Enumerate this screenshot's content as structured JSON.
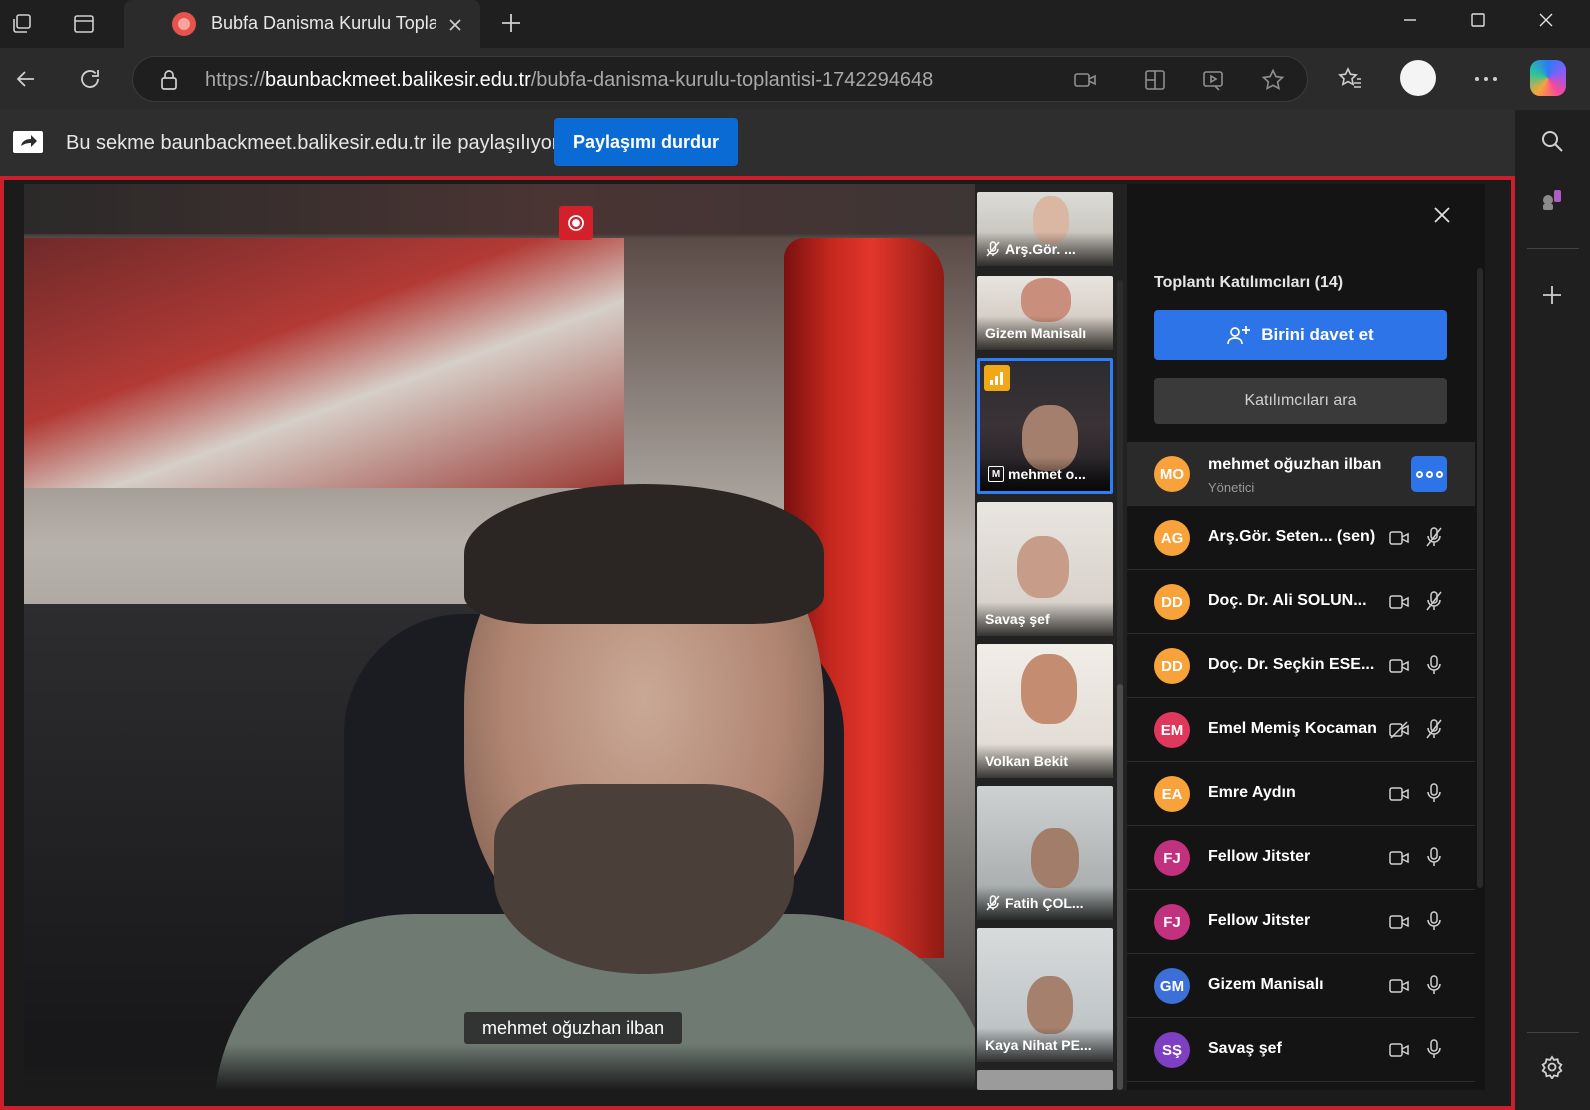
{
  "browser": {
    "tab_title": "Bubfa Danisma Kurulu Toplantısı",
    "url_scheme": "https://",
    "url_host": "baunbackmeet.balikesir.edu.tr",
    "url_path": "/bubfa-danisma-kurulu-toplantisi-1742294648",
    "icons": [
      "collections-icon",
      "tab-actions-icon",
      "favicon-icon",
      "close-icon",
      "new-tab-icon",
      "minimize-icon",
      "maximize-icon",
      "window-close-icon",
      "back-icon",
      "refresh-icon",
      "lock-icon",
      "camera-icon",
      "split-screen-icon",
      "immersive-reader-icon",
      "star-icon",
      "favorites-icon",
      "profile-icon",
      "more-icon",
      "copilot-icon",
      "search-icon",
      "games-icon",
      "add-icon",
      "settings-icon"
    ]
  },
  "share_bar": {
    "message": "Bu sekme baunbackmeet.balikesir.edu.tr ile paylaşılıyor",
    "stop_button": "Paylaşımı durdur"
  },
  "meeting": {
    "active_speaker": "mehmet oğuzhan ilban",
    "recording": true,
    "thumbnails": [
      {
        "name": "Arş.Gör. ...",
        "muted": true
      },
      {
        "name": "Gizem Manisalı",
        "muted": false
      },
      {
        "name": "mehmet o...",
        "muted": false,
        "active": true
      },
      {
        "name": "Savaş şef",
        "muted": false
      },
      {
        "name": "Volkan Bekit",
        "muted": false
      },
      {
        "name": "Fatih ÇOL...",
        "muted": true
      },
      {
        "name": "Kaya Nihat PE...",
        "muted": false
      }
    ],
    "thumb_badge": "M"
  },
  "participants_panel": {
    "title": "Toplantı Katılımcıları (14)",
    "invite_label": "Birini davet et",
    "search_placeholder": "Katılımcıları ara",
    "host": {
      "initials": "MO",
      "name": "mehmet oğuzhan ilban",
      "role": "Yönetici",
      "color": "#f7a23a"
    },
    "participants": [
      {
        "initials": "AG",
        "name": "Arş.Gör. Seten... (sen)",
        "color": "#f7a23a",
        "mic_muted": true,
        "cam_off": false
      },
      {
        "initials": "DD",
        "name": "Doç. Dr. Ali SOLUN...",
        "color": "#f7a23a",
        "mic_muted": true,
        "cam_off": false
      },
      {
        "initials": "DD",
        "name": "Doç. Dr. Seçkin ESE...",
        "color": "#f7a23a",
        "mic_muted": false,
        "cam_off": false
      },
      {
        "initials": "EM",
        "name": "Emel Memiş Kocaman",
        "color": "#e0385d",
        "mic_muted": true,
        "cam_off": true
      },
      {
        "initials": "EA",
        "name": "Emre Aydın",
        "color": "#f7a23a",
        "mic_muted": false,
        "cam_off": false
      },
      {
        "initials": "FJ",
        "name": "Fellow Jitster",
        "color": "#c2317d",
        "mic_muted": false,
        "cam_off": false
      },
      {
        "initials": "FJ",
        "name": "Fellow Jitster",
        "color": "#c2317d",
        "mic_muted": false,
        "cam_off": false
      },
      {
        "initials": "GM",
        "name": "Gizem Manisalı",
        "color": "#3d6fd8",
        "mic_muted": false,
        "cam_off": false
      },
      {
        "initials": "SŞ",
        "name": "Savaş şef",
        "color": "#7e3fc2",
        "mic_muted": false,
        "cam_off": false
      }
    ]
  },
  "colors": {
    "accent": "#2d74e8",
    "share_border": "#c9202c",
    "stop_share": "#0b6bd4"
  }
}
